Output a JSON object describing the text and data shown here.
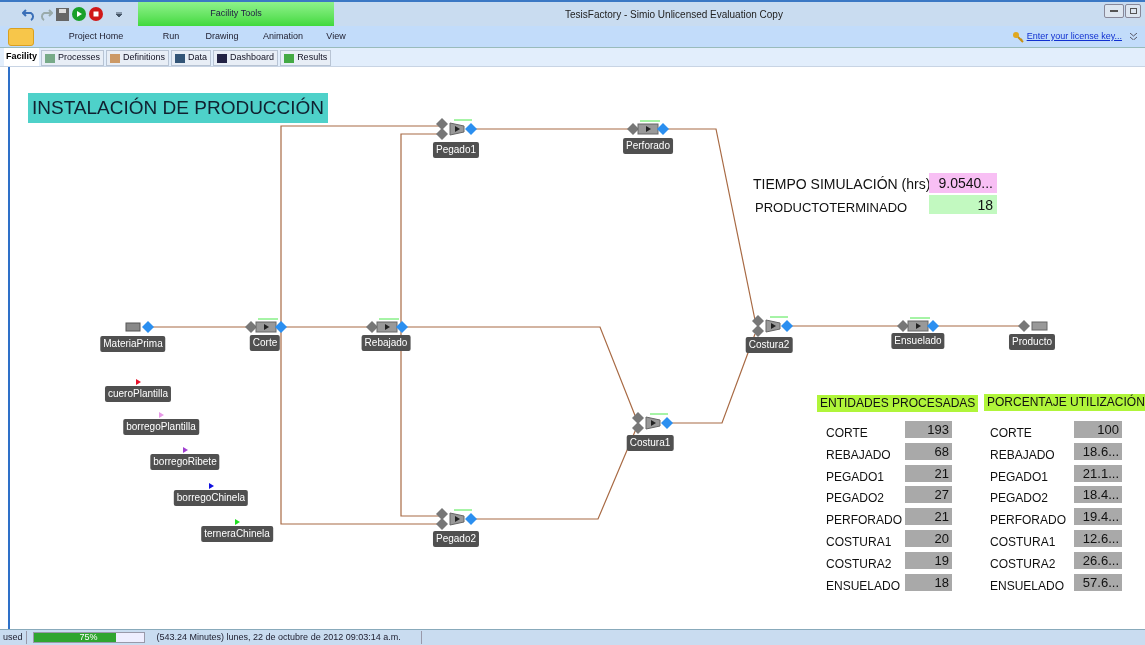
{
  "window": {
    "title": "TesisFactory - Simio Unlicensed Evaluation Copy"
  },
  "contextual_tab": "Facility Tools",
  "ribbon_tabs": [
    "Project Home",
    "Run",
    "Drawing",
    "Animation",
    "View"
  ],
  "license_link": "Enter your license key...",
  "view_tabs": [
    {
      "label": "Facility",
      "selected": true
    },
    {
      "label": "Processes",
      "selected": false
    },
    {
      "label": "Definitions",
      "selected": false
    },
    {
      "label": "Data",
      "selected": false
    },
    {
      "label": "Dashboard",
      "selected": false
    },
    {
      "label": "Results",
      "selected": false
    }
  ],
  "canvas": {
    "title": "INSTALACIÓN DE PRODUCCIÓN",
    "nodes": [
      {
        "name": "MateriaPrima",
        "kind": "source"
      },
      {
        "name": "Corte",
        "kind": "server"
      },
      {
        "name": "Rebajado",
        "kind": "server"
      },
      {
        "name": "Pegado1",
        "kind": "combiner"
      },
      {
        "name": "Perforado",
        "kind": "server"
      },
      {
        "name": "Pegado2",
        "kind": "combiner"
      },
      {
        "name": "Costura1",
        "kind": "combiner"
      },
      {
        "name": "Costura2",
        "kind": "combiner"
      },
      {
        "name": "Ensuelado",
        "kind": "server"
      },
      {
        "name": "Producto",
        "kind": "sink"
      }
    ],
    "entities": [
      {
        "name": "cueroPlantilla",
        "color": "#e8102a"
      },
      {
        "name": "borregoPlantilla",
        "color": "#e89ae8"
      },
      {
        "name": "borregoRibete",
        "color": "#a040d0"
      },
      {
        "name": "borregoChinela",
        "color": "#1010e0"
      },
      {
        "name": "terneraChinela",
        "color": "#20e020"
      }
    ],
    "simulation_time": {
      "label": "TIEMPO SIMULACIÓN (hrs)",
      "value": "9.0540..."
    },
    "finished_products": {
      "label": "PRODUCTOTERMINADO",
      "value": "18"
    },
    "processed_entities": {
      "heading": "ENTIDADES PROCESADAS",
      "rows": [
        {
          "label": "CORTE",
          "value": "193"
        },
        {
          "label": "REBAJADO",
          "value": "68"
        },
        {
          "label": "PEGADO1",
          "value": "21"
        },
        {
          "label": "PEGADO2",
          "value": "27"
        },
        {
          "label": "PERFORADO",
          "value": "21"
        },
        {
          "label": "COSTURA1",
          "value": "20"
        },
        {
          "label": "COSTURA2",
          "value": "19"
        },
        {
          "label": "ENSUELADO",
          "value": "18"
        }
      ]
    },
    "utilization": {
      "heading": "PORCENTAJE  UTILIZACIÓN",
      "rows": [
        {
          "label": "CORTE",
          "value": "100"
        },
        {
          "label": "REBAJADO",
          "value": "18.6..."
        },
        {
          "label": "PEGADO1",
          "value": "21.1..."
        },
        {
          "label": "PEGADO2",
          "value": "18.4..."
        },
        {
          "label": "PERFORADO",
          "value": "19.4..."
        },
        {
          "label": "COSTURA1",
          "value": "12.6..."
        },
        {
          "label": "COSTURA2",
          "value": "26.6..."
        },
        {
          "label": "ENSUELADO",
          "value": "57.6..."
        }
      ]
    }
  },
  "status_bar": {
    "state": "used",
    "progress": {
      "level": 0.75,
      "label": "75%"
    },
    "message": "(543.24 Minutes) lunes, 22 de octubre de 2012 09:03:14 a.m."
  }
}
